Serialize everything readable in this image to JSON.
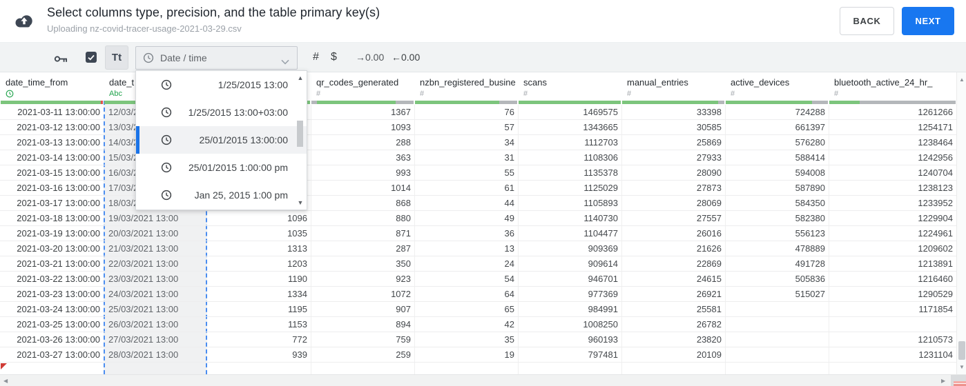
{
  "header": {
    "title": "Select columns type, precision, and the table primary key(s)",
    "subtitle": "Uploading nz-covid-tracer-usage-2021-03-29.csv",
    "back_label": "BACK",
    "next_label": "NEXT"
  },
  "toolbar": {
    "text_type_label": "Tt",
    "type_dropdown_value": "Date / time",
    "number_label": "#",
    "currency_label": "$",
    "increase_decimal_label": "→0.00",
    "decrease_decimal_label": "←0.00",
    "checkbox_checked": true
  },
  "format_dropdown": {
    "options": [
      {
        "label": "1/25/2015 13:00",
        "selected": false
      },
      {
        "label": "1/25/2015 13:00+03:00",
        "selected": false
      },
      {
        "label": "25/01/2015 13:00:00",
        "selected": true
      },
      {
        "label": "25/01/2015 1:00:00 pm",
        "selected": false
      },
      {
        "label": "Jan 25, 2015 1:00 pm",
        "selected": false
      }
    ]
  },
  "table": {
    "columns": [
      {
        "name": "date_time_from",
        "type": "clock"
      },
      {
        "name": "date_t",
        "type": "Abc"
      },
      {
        "name": "",
        "type": ""
      },
      {
        "name": "qr_codes_generated",
        "type": "#"
      },
      {
        "name": "nzbn_registered_busine",
        "type": "#"
      },
      {
        "name": "scans",
        "type": "#"
      },
      {
        "name": "manual_entries",
        "type": "#"
      },
      {
        "name": "active_devices",
        "type": "#"
      },
      {
        "name": "bluetooth_active_24_hr_",
        "type": "#"
      }
    ],
    "quality_bars": [
      [
        [
          "green",
          145
        ],
        [
          "red",
          3
        ]
      ],
      [
        [
          "green",
          148
        ]
      ],
      [
        [
          "green",
          148
        ]
      ],
      [
        [
          "gray",
          8
        ],
        [
          "green",
          114
        ],
        [
          "gray",
          26
        ]
      ],
      [
        [
          "green",
          122
        ],
        [
          "gray",
          26
        ]
      ],
      [
        [
          "green",
          148
        ]
      ],
      [
        [
          "green",
          139
        ],
        [
          "gray",
          9
        ]
      ],
      [
        [
          "green",
          125
        ],
        [
          "gray",
          23
        ]
      ],
      [
        [
          "green",
          44
        ],
        [
          "gray",
          139
        ]
      ]
    ],
    "rows": [
      [
        "2021-03-11 13:00:00",
        "12/03/2",
        "",
        "1367",
        "76",
        "1469575",
        "33398",
        "724288",
        "1261266"
      ],
      [
        "2021-03-12 13:00:00",
        "13/03/2",
        "",
        "1093",
        "57",
        "1343665",
        "30585",
        "661397",
        "1254171"
      ],
      [
        "2021-03-13 13:00:00",
        "14/03/2",
        "",
        "288",
        "34",
        "1112703",
        "25869",
        "576280",
        "1238464"
      ],
      [
        "2021-03-14 13:00:00",
        "15/03/2",
        "",
        "363",
        "31",
        "1108306",
        "27933",
        "588414",
        "1242956"
      ],
      [
        "2021-03-15 13:00:00",
        "16/03/2",
        "",
        "993",
        "55",
        "1135378",
        "28090",
        "594008",
        "1240704"
      ],
      [
        "2021-03-16 13:00:00",
        "17/03/2",
        "",
        "1014",
        "61",
        "1125029",
        "27873",
        "587890",
        "1238123"
      ],
      [
        "2021-03-17 13:00:00",
        "18/03/2",
        "",
        "868",
        "44",
        "1105893",
        "28069",
        "584350",
        "1233952"
      ],
      [
        "2021-03-18 13:00:00",
        "19/03/2021 13:00",
        "1096",
        "880",
        "49",
        "1140730",
        "27557",
        "582380",
        "1229904"
      ],
      [
        "2021-03-19 13:00:00",
        "20/03/2021 13:00",
        "1035",
        "871",
        "36",
        "1104477",
        "26016",
        "556123",
        "1224961"
      ],
      [
        "2021-03-20 13:00:00",
        "21/03/2021 13:00",
        "1313",
        "287",
        "13",
        "909369",
        "21626",
        "478889",
        "1209602"
      ],
      [
        "2021-03-21 13:00:00",
        "22/03/2021 13:00",
        "1203",
        "350",
        "24",
        "909614",
        "22869",
        "491728",
        "1213891"
      ],
      [
        "2021-03-22 13:00:00",
        "23/03/2021 13:00",
        "1190",
        "923",
        "54",
        "946701",
        "24615",
        "505836",
        "1216460"
      ],
      [
        "2021-03-23 13:00:00",
        "24/03/2021 13:00",
        "1334",
        "1072",
        "64",
        "977369",
        "26921",
        "515027",
        "1290529"
      ],
      [
        "2021-03-24 13:00:00",
        "25/03/2021 13:00",
        "1195",
        "907",
        "65",
        "984991",
        "25581",
        "",
        "1171854"
      ],
      [
        "2021-03-25 13:00:00",
        "26/03/2021 13:00",
        "1153",
        "894",
        "42",
        "1008250",
        "26782",
        "",
        ""
      ],
      [
        "2021-03-26 13:00:00",
        "27/03/2021 13:00",
        "772",
        "759",
        "35",
        "960193",
        "23820",
        "",
        "1210573"
      ],
      [
        "2021-03-27 13:00:00",
        "28/03/2021 13:00",
        "939",
        "259",
        "19",
        "797481",
        "20109",
        "",
        "1231104"
      ],
      [
        "",
        "",
        "",
        "",
        "",
        "",
        "",
        "",
        ""
      ]
    ]
  },
  "colors": {
    "accent_blue": "#1877f0",
    "selection_dash_blue": "#4a8df0",
    "selected_option_blue": "#1a73e8",
    "type_green": "#1fa24a",
    "bar_green": "#7cc57c",
    "bar_gray": "#b4b7ba",
    "bar_red": "#e0524e",
    "flag_red": "#cf3b35"
  }
}
